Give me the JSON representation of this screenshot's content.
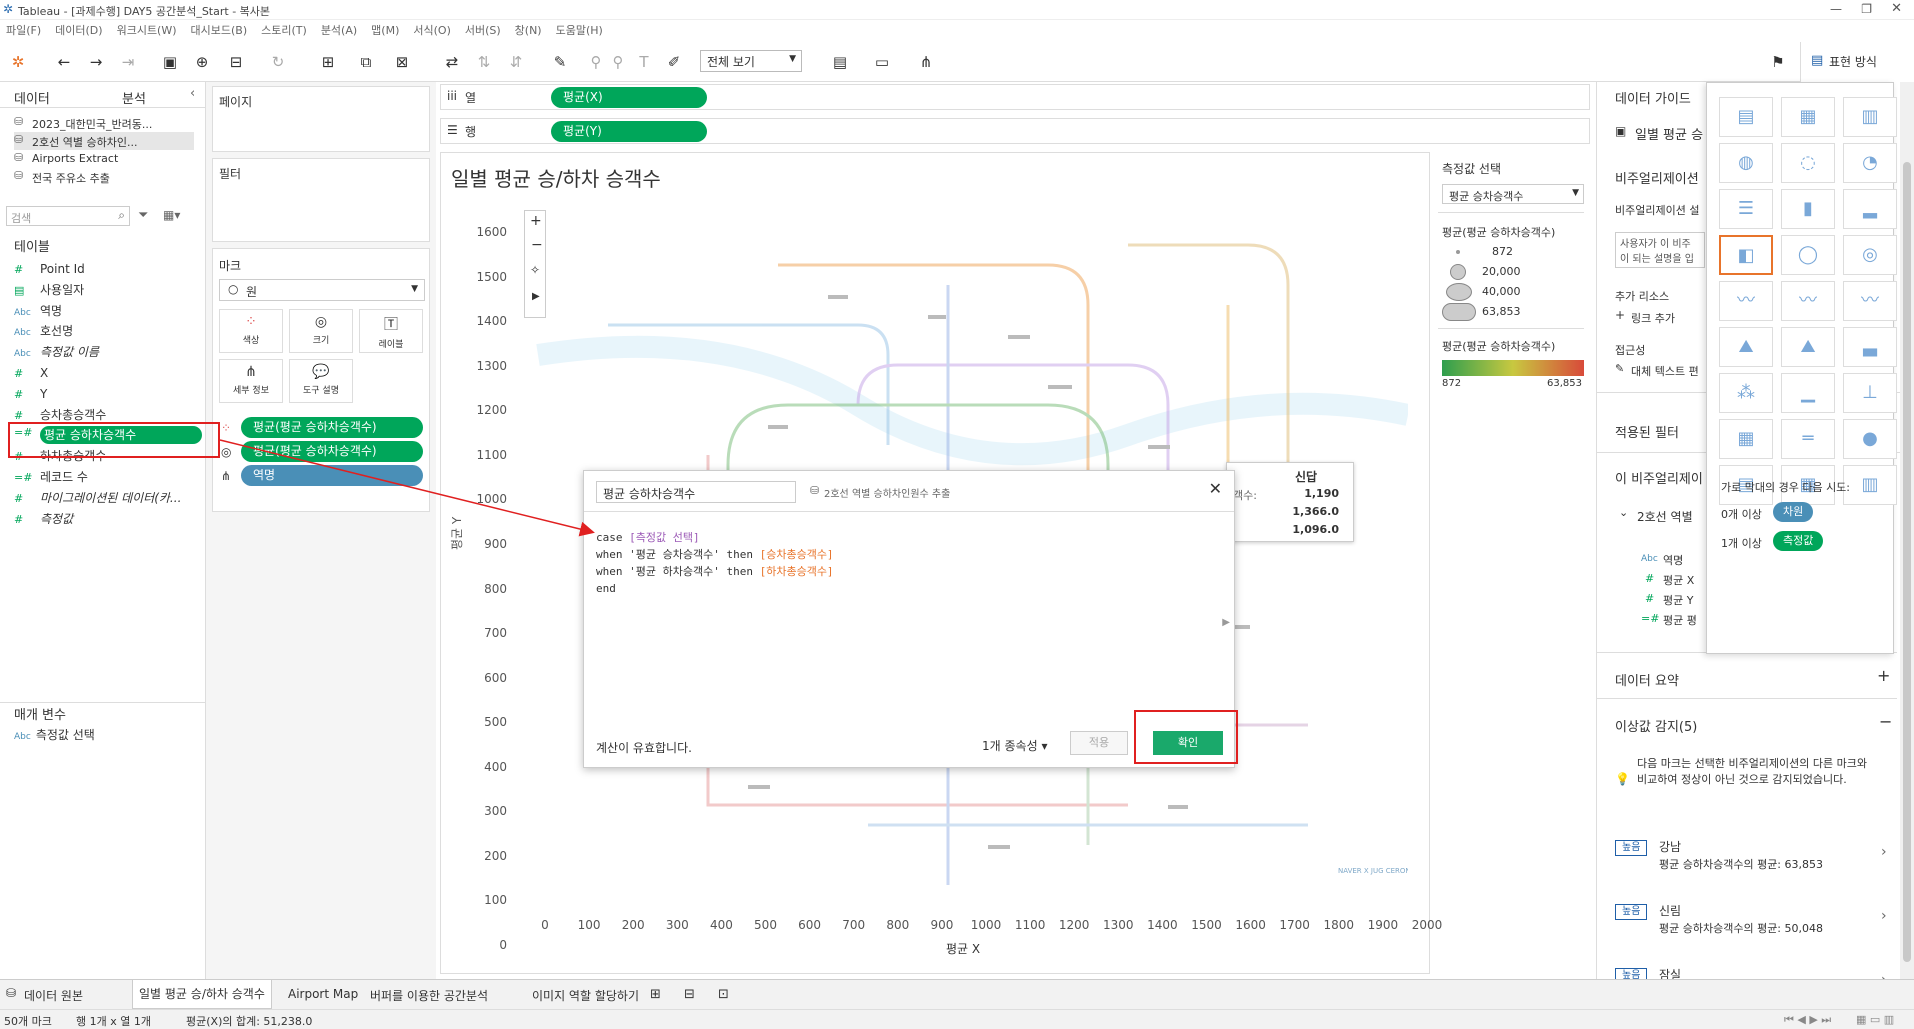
{
  "window": {
    "title": "Tableau - [과제수행] DAY5 공간분석_Start - 복사본"
  },
  "menu": [
    "파일(F)",
    "데이터(D)",
    "워크시트(W)",
    "대시보드(B)",
    "스토리(T)",
    "분석(A)",
    "맵(M)",
    "서식(O)",
    "서버(S)",
    "창(N)",
    "도움말(H)"
  ],
  "toolbar": {
    "view_select": "전체 보기",
    "show_me": "표현 방식"
  },
  "left_panel": {
    "tabs": [
      "데이터",
      "분석"
    ],
    "datasources": [
      "2023_대한민국_반려동...",
      "2호선 역별 승하차인...",
      "Airports Extract",
      "전국 주유소 추출"
    ],
    "search_placeholder": "검색",
    "tables_label": "테이블",
    "fields": [
      {
        "icon": "#",
        "name": "Point Id"
      },
      {
        "icon": "date",
        "name": "사용일자"
      },
      {
        "icon": "Abc",
        "name": "역명"
      },
      {
        "icon": "Abc",
        "name": "호선명"
      },
      {
        "icon": "Abc",
        "name": "측정값 이름"
      },
      {
        "icon": "#",
        "name": "X"
      },
      {
        "icon": "#",
        "name": "Y"
      },
      {
        "icon": "#",
        "name": "승차총승객수"
      },
      {
        "icon": "=#",
        "name": "평균 승하차승객수"
      },
      {
        "icon": "#",
        "name": "하차총승객수"
      },
      {
        "icon": "=#",
        "name": "레코드 수"
      },
      {
        "icon": "#",
        "name": "마이그레이션된 데이터(카..."
      },
      {
        "icon": "#",
        "name": "측정값"
      }
    ],
    "params_label": "매개 변수",
    "params": [
      {
        "icon": "Abc",
        "name": "측정값 선택"
      }
    ]
  },
  "shelves": {
    "pages": "페이지",
    "filters": "필터",
    "marks": "마크",
    "mark_type": "원",
    "mark_buttons": [
      "색상",
      "크기",
      "레이블",
      "세부 정보",
      "도구 설명"
    ],
    "mark_pills": [
      "평균(평균 승하차승객수)",
      "평균(평균 승하차승객수)",
      "역명"
    ],
    "columns_label": "열",
    "rows_label": "행",
    "columns_pill": "평균(X)",
    "rows_pill": "평균(Y)"
  },
  "chart": {
    "title": "일별 평균 승/하차 승객수",
    "y_ticks": [
      "1600",
      "1500",
      "1400",
      "1300",
      "1200",
      "1100",
      "1000",
      "900",
      "800",
      "700",
      "600",
      "500",
      "400",
      "300",
      "200",
      "100",
      "0"
    ],
    "x_ticks": [
      "0",
      "100",
      "200",
      "300",
      "400",
      "500",
      "600",
      "700",
      "800",
      "900",
      "1000",
      "1100",
      "1200",
      "1300",
      "1400",
      "1500",
      "1600",
      "1700",
      "1800",
      "1900",
      "2000"
    ],
    "xlabel": "평균 X",
    "ylabel": "평균 Y",
    "map_credit": "NAVER X JUG CERONIC",
    "tooltip": {
      "title": "신답",
      "partial_label": "객수:",
      "values": [
        "1,190",
        "1,366.0",
        "1,096.0"
      ]
    }
  },
  "legends": {
    "measure_select_title": "측정값 선택",
    "measure_select_value": "평균 승차승객수",
    "size_title": "평균(평균 승하차승객수)",
    "size_values": [
      "872",
      "20,000",
      "40,000",
      "63,853"
    ],
    "color_title": "평균(평균 승하차승객수)",
    "color_min": "872",
    "color_max": "63,853"
  },
  "dialog": {
    "name": "평균 승하차승객수",
    "source": "2호선 역별 승하차인원수 추출",
    "code": [
      [
        {
          "t": "case ",
          "c": "kw"
        },
        {
          "t": "[측정값 선택]",
          "c": "param"
        }
      ],
      [
        {
          "t": "when ",
          "c": "kw"
        },
        {
          "t": "'평균 승차승객수' ",
          "c": "str"
        },
        {
          "t": "then ",
          "c": "kw"
        },
        {
          "t": "[승차총승객수]",
          "c": "fld"
        }
      ],
      [
        {
          "t": "when ",
          "c": "kw"
        },
        {
          "t": "'평균 하차승객수' ",
          "c": "str"
        },
        {
          "t": "then ",
          "c": "kw"
        },
        {
          "t": "[하차총승객수]",
          "c": "fld"
        }
      ],
      [
        {
          "t": "end",
          "c": "kw"
        }
      ]
    ],
    "status": "계산이 유효합니다.",
    "dependency": "1개 종속성",
    "apply": "적용",
    "ok": "확인"
  },
  "right_panel": {
    "title": "데이터 가이드",
    "sheet_label": "일별 평균 승",
    "viz_title": "비주얼리제이션",
    "viz_desc_label": "비주얼리제이션 설",
    "viz_desc_text": "사용자가 이 비주 이 되는 설명을 입",
    "resources": "추가 리소스",
    "add_link": "링크 추가",
    "accessibility": "접근성",
    "alt_text": "대체 텍스트 편",
    "applied_filters": "적용된 필터",
    "this_viz": "이 비주얼리제이",
    "source_short": "2호선 역별",
    "source_fields": [
      "역명",
      "평균 X",
      "평균 Y",
      "평균 평"
    ],
    "data_summary": "데이터 요약",
    "outliers": "이상값 감지(5)",
    "outlier_desc": "다음 마크는 선택한 비주얼리제이션의 다른 마크와 비교하여 정상이 아닌 것으로 감지되었습니다.",
    "outlier_items": [
      {
        "badge": "높음",
        "name": "강남",
        "detail": "평균 승하차승객수의 평균: 63,853"
      },
      {
        "badge": "높음",
        "name": "신림",
        "detail": "평균 승하차승객수의 평균: 50,048"
      },
      {
        "badge": "높음",
        "name": "잠실",
        "detail": ""
      }
    ]
  },
  "show_me": {
    "hint": "가로 막대의 경우 다음 시도:",
    "row1_prefix": "0개 이상",
    "row1_pill": "차원",
    "row2_prefix": "1개 이상",
    "row2_pill": "측정값"
  },
  "sheet_tabs": [
    "데이터 원본",
    "일별 평균 승/하차 승객수",
    "Airport Map",
    "버퍼를 이용한 공간분석",
    "이미지 역할 할당하기"
  ],
  "status": {
    "marks": "50개 마크",
    "rows_cols": "행 1개 x 열 1개",
    "sum": "평균(X)의 합계: 51,238.0"
  }
}
